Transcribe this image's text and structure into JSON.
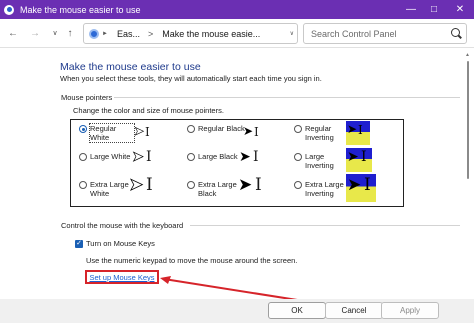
{
  "window": {
    "title": "Make the mouse easier to use"
  },
  "nav": {
    "crumb1": "Eas...",
    "crumb2": "Make the mouse easie...",
    "search_placeholder": "Search Control Panel"
  },
  "page": {
    "title": "Make the mouse easier to use",
    "intro": "When you select these tools, they will automatically start each time you sign in."
  },
  "pointers": {
    "section": "Mouse pointers",
    "sub": "Change the color and size of mouse pointers.",
    "options": [
      {
        "label": "Regular White",
        "checked": true
      },
      {
        "label": "Regular Black",
        "checked": false
      },
      {
        "label": "Regular Inverting",
        "checked": false
      },
      {
        "label": "Large White",
        "checked": false
      },
      {
        "label": "Large Black",
        "checked": false
      },
      {
        "label": "Large Inverting",
        "checked": false
      },
      {
        "label": "Extra Large White",
        "checked": false
      },
      {
        "label": "Extra Large Black",
        "checked": false
      },
      {
        "label": "Extra Large Inverting",
        "checked": false
      }
    ]
  },
  "keyboard": {
    "section": "Control the mouse with the keyboard",
    "mouse_keys_label": "Turn on Mouse Keys",
    "mouse_keys_checked": true,
    "mouse_keys_desc": "Use the numeric keypad to move the mouse around the screen.",
    "setup_link": "Set up Mouse Keys"
  },
  "buttons": {
    "ok": "OK",
    "cancel": "Cancel",
    "apply": "Apply"
  },
  "colors": {
    "titlebar": "#6b2fb3",
    "link": "#1a5fd0",
    "highlight": "#d6242a",
    "title_text": "#1e3a8c"
  }
}
